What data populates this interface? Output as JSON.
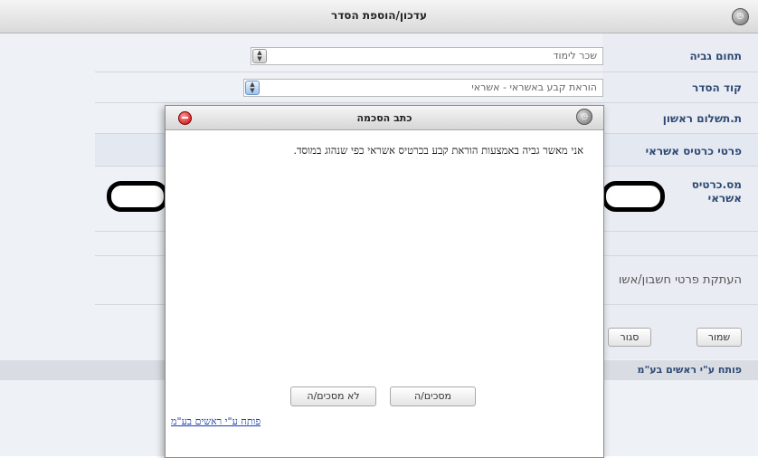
{
  "window": {
    "title": "עדכון/הוספת הסדר",
    "app_icon": "clock-logo-icon"
  },
  "form": {
    "rows": [
      {
        "label": "תחום גביה",
        "value": "שכר לימוד"
      },
      {
        "label": "קוד הסדר",
        "value": "הוראת קבע באשראי - אשראי"
      },
      {
        "label": "ת.תשלום ראשון",
        "value": ""
      },
      {
        "label": "פרטי כרטיס אשראי",
        "value": ""
      },
      {
        "label": "מס.כרטיס אשראי",
        "value": ""
      }
    ],
    "copy_details_label": "העתקת פרטי חשבון/אשו",
    "save_label": "שמור",
    "close_label": "סגור",
    "opened_by": "פותח ע\"י ראשים בע\"מ"
  },
  "modal": {
    "title": "כתב הסכמה",
    "body_text": "אני מאשר גביה באמצעות הוראת קבע בכרטיס אשראי כפי שנהוג במוסד.",
    "agree_label": "מסכים/ה",
    "disagree_label": "לא מסכים/ה",
    "developer_link": "פותח ע\"י ראשים בע\"מ"
  },
  "colors": {
    "label_text": "#2f4a74",
    "link": "#1b3fa8",
    "close_button": "#c80000"
  }
}
